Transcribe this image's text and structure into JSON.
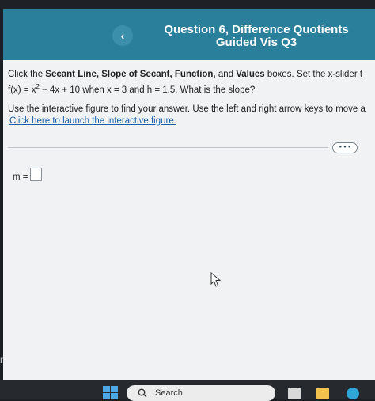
{
  "header": {
    "back_glyph": "‹",
    "title_line1": "Question 6, Difference Quotients",
    "title_line2": "Guided Vis Q3"
  },
  "question": {
    "p1_pre": "Click the ",
    "p1_b1": "Secant Line, Slope of Secant, Function,",
    "p1_mid": " and ",
    "p1_b2": "Values",
    "p1_post": " boxes. Set the x-slider t",
    "p2_fx": "f(x) = x",
    "p2_exp": "2",
    "p2_rest": " − 4x + 10 when x = 3 and h = 1.5. What is the slope?",
    "p3": "Use the interactive figure to find your answer. Use the left and right arrow keys to move a",
    "link": "Click here to launch the interactive figure."
  },
  "more_button": "• • •",
  "answer": {
    "label": "m ="
  },
  "side_text": "r",
  "taskbar": {
    "search_text": "Search",
    "colors": {
      "background": "#26292d",
      "windows": "#4ea8e6",
      "folder": "#f2c14e",
      "edge": "#2fa6d6"
    }
  },
  "colors": {
    "header": "#2a7f9b",
    "link": "#1a5fa8",
    "content_bg": "#f0f2f3"
  }
}
